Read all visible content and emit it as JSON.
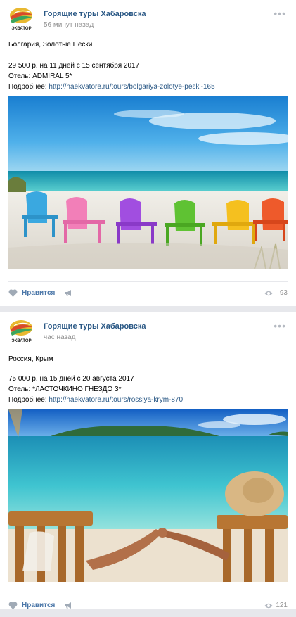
{
  "posts": [
    {
      "author": "Горящие туры Хабаровска",
      "logo_text": "ЭКВАТОР",
      "time": "56 минут назад",
      "destination": "Болгария, Золотые Пески",
      "price_line": "29 500 р. на 11 дней с 15 сентября 2017",
      "hotel_line": "Отель: ADMIRAL 5*",
      "more_label": "Подробнее: ",
      "link": "http://naekvatore.ru/tours/bolgariya-zolotye-peski-165",
      "photo_icon": "beach-chairs-photo",
      "like_label": "Нравится",
      "views": "93"
    },
    {
      "author": "Горящие туры Хабаровска",
      "logo_text": "ЭКВАТОР",
      "time": "час назад",
      "destination": "Россия, Крым",
      "price_line": "75 000 р. на 15 дней с 20 августа 2017",
      "hotel_line": "Отель: *ЛАСТОЧКИНО ГНЕЗДО 3*",
      "more_label": "Подробнее: ",
      "link": "http://naekvatore.ru/tours/rossiya-krym-870",
      "photo_icon": "couple-beach-photo",
      "like_label": "Нравится",
      "views": "121"
    }
  ],
  "icons": {
    "more": "more-dots-icon",
    "like": "heart-icon",
    "share": "share-megaphone-icon",
    "views": "eye-icon"
  },
  "colors": {
    "link": "#2a5885",
    "like": "#4a76a8",
    "muted": "#939393",
    "background": "#e7e8ec"
  }
}
